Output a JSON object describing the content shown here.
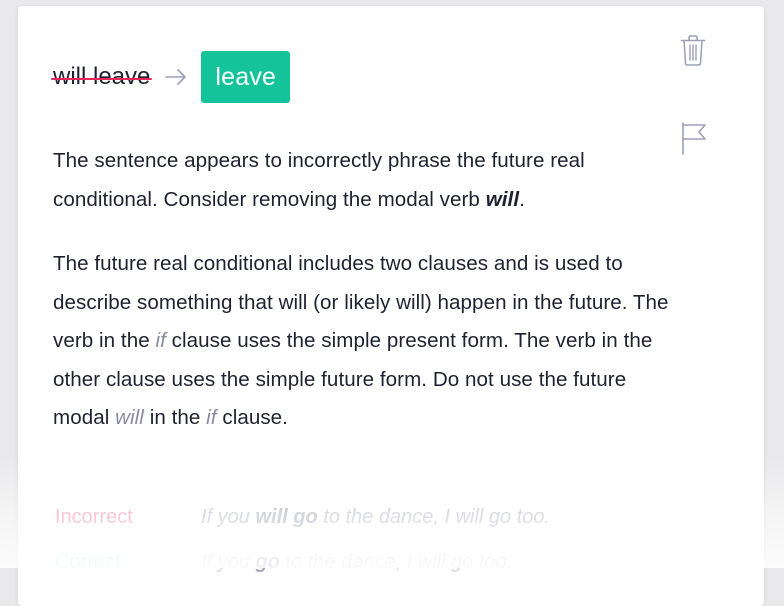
{
  "suggestion": {
    "original": "will leave",
    "replacement": "leave",
    "accent_color": "#15c39a",
    "strike_color": "#e6265a",
    "arrow_icon": "arrow-right-icon"
  },
  "actions": {
    "dismiss_icon": "trash-icon",
    "flag_icon": "flag-icon"
  },
  "explanation": {
    "p1_before": "The sentence appears to incorrectly phrase the future real conditional. Consider removing the modal verb ",
    "p1_keyword": "will",
    "p1_after": ".",
    "p2_a": "The future real conditional includes two clauses and is used to describe something that will (or likely will) happen in the future. The verb in the ",
    "p2_if1": "if",
    "p2_b": " clause uses the simple present form. The verb in the other clause uses the simple future form. Do not use the future modal ",
    "p2_will": "will",
    "p2_c": " in the ",
    "p2_if2": "if",
    "p2_d": " clause."
  },
  "examples": [
    {
      "label": "Incorrect",
      "pre": "If you ",
      "emph": "will go",
      "post": " to the dance, I will go too."
    },
    {
      "label": "Correct",
      "pre": "If you ",
      "emph": "go",
      "post": " to the dance, I will go too."
    }
  ]
}
